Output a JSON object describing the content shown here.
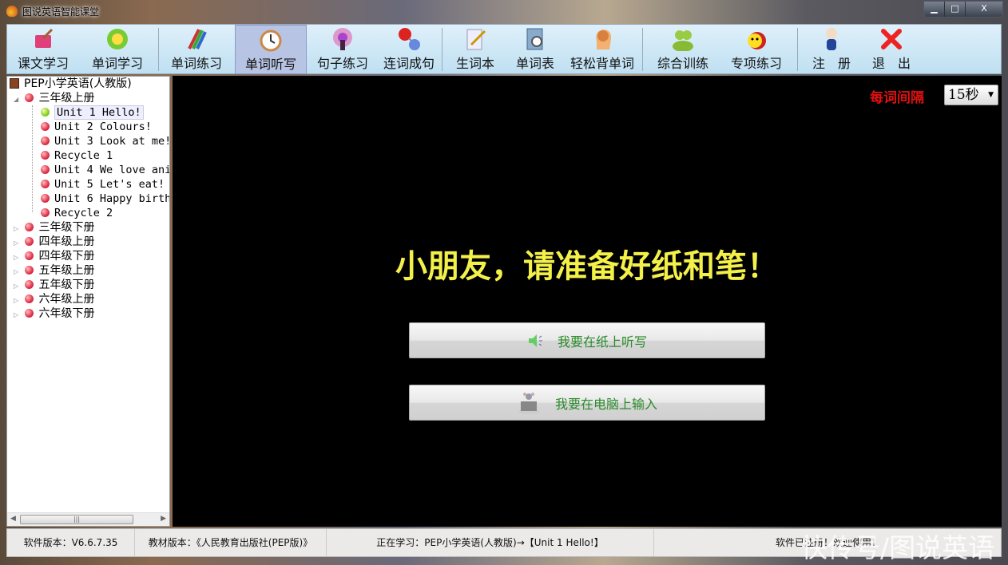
{
  "window": {
    "title": "图说英语智能课堂",
    "minimize": "▁",
    "maximize": "□",
    "close": "X"
  },
  "toolbar": [
    {
      "label": "课文学习",
      "icon": "book-pen-icon"
    },
    {
      "label": "单词学习",
      "icon": "flower-icon"
    },
    {
      "label": "单词练习",
      "icon": "pencils-icon"
    },
    {
      "label": "单词听写",
      "icon": "clock-pen-icon",
      "active": true
    },
    {
      "label": "句子练习",
      "icon": "podcast-icon"
    },
    {
      "label": "连词成句",
      "icon": "link-bubbles-icon"
    },
    {
      "label": "生词本",
      "icon": "notepad-icon"
    },
    {
      "label": "单词表",
      "icon": "notebook-search-icon"
    },
    {
      "label": "轻松背单词",
      "icon": "brain-icon"
    },
    {
      "label": "综合训练",
      "icon": "users-icon"
    },
    {
      "label": "专项练习",
      "icon": "ladybug-icon"
    },
    {
      "label": "注　册",
      "icon": "user-icon"
    },
    {
      "label": "退　出",
      "icon": "red-x-icon"
    }
  ],
  "tree": {
    "root": "PEP小学英语(人教版)",
    "expanded": {
      "label": "三年级上册",
      "children": [
        "Unit 1 Hello!",
        "Unit 2 Colours!",
        "Unit 3 Look at me!",
        "Recycle 1",
        "Unit 4 We love ani",
        "Unit 5 Let's eat!",
        "Unit 6 Happy birth",
        "Recycle 2"
      ],
      "selected": 0
    },
    "collapsed": [
      "三年级下册",
      "四年级上册",
      "四年级下册",
      "五年级上册",
      "五年级下册",
      "六年级上册",
      "六年级下册"
    ]
  },
  "main": {
    "interval_label": "每词间隔",
    "interval_value": "15秒",
    "prompt": "小朋友，请准备好纸和笔！",
    "paper_button": "我要在纸上听写",
    "computer_button": "我要在电脑上输入"
  },
  "status": {
    "version": "软件版本：V6.6.7.35",
    "textbook": "教材版本：《人民教育出版社(PEP版)》",
    "learning": "正在学习：PEP小学英语(人教版)→【Unit 1 Hello!】",
    "registered": "软件已注册！欢迎使用！"
  },
  "watermark": "快传号/图说英语",
  "colors": {
    "prompt": "#f4f04a",
    "interval_label": "#e01010",
    "button_text": "#2a8a2a",
    "active_tab": "#b8c4e4"
  }
}
